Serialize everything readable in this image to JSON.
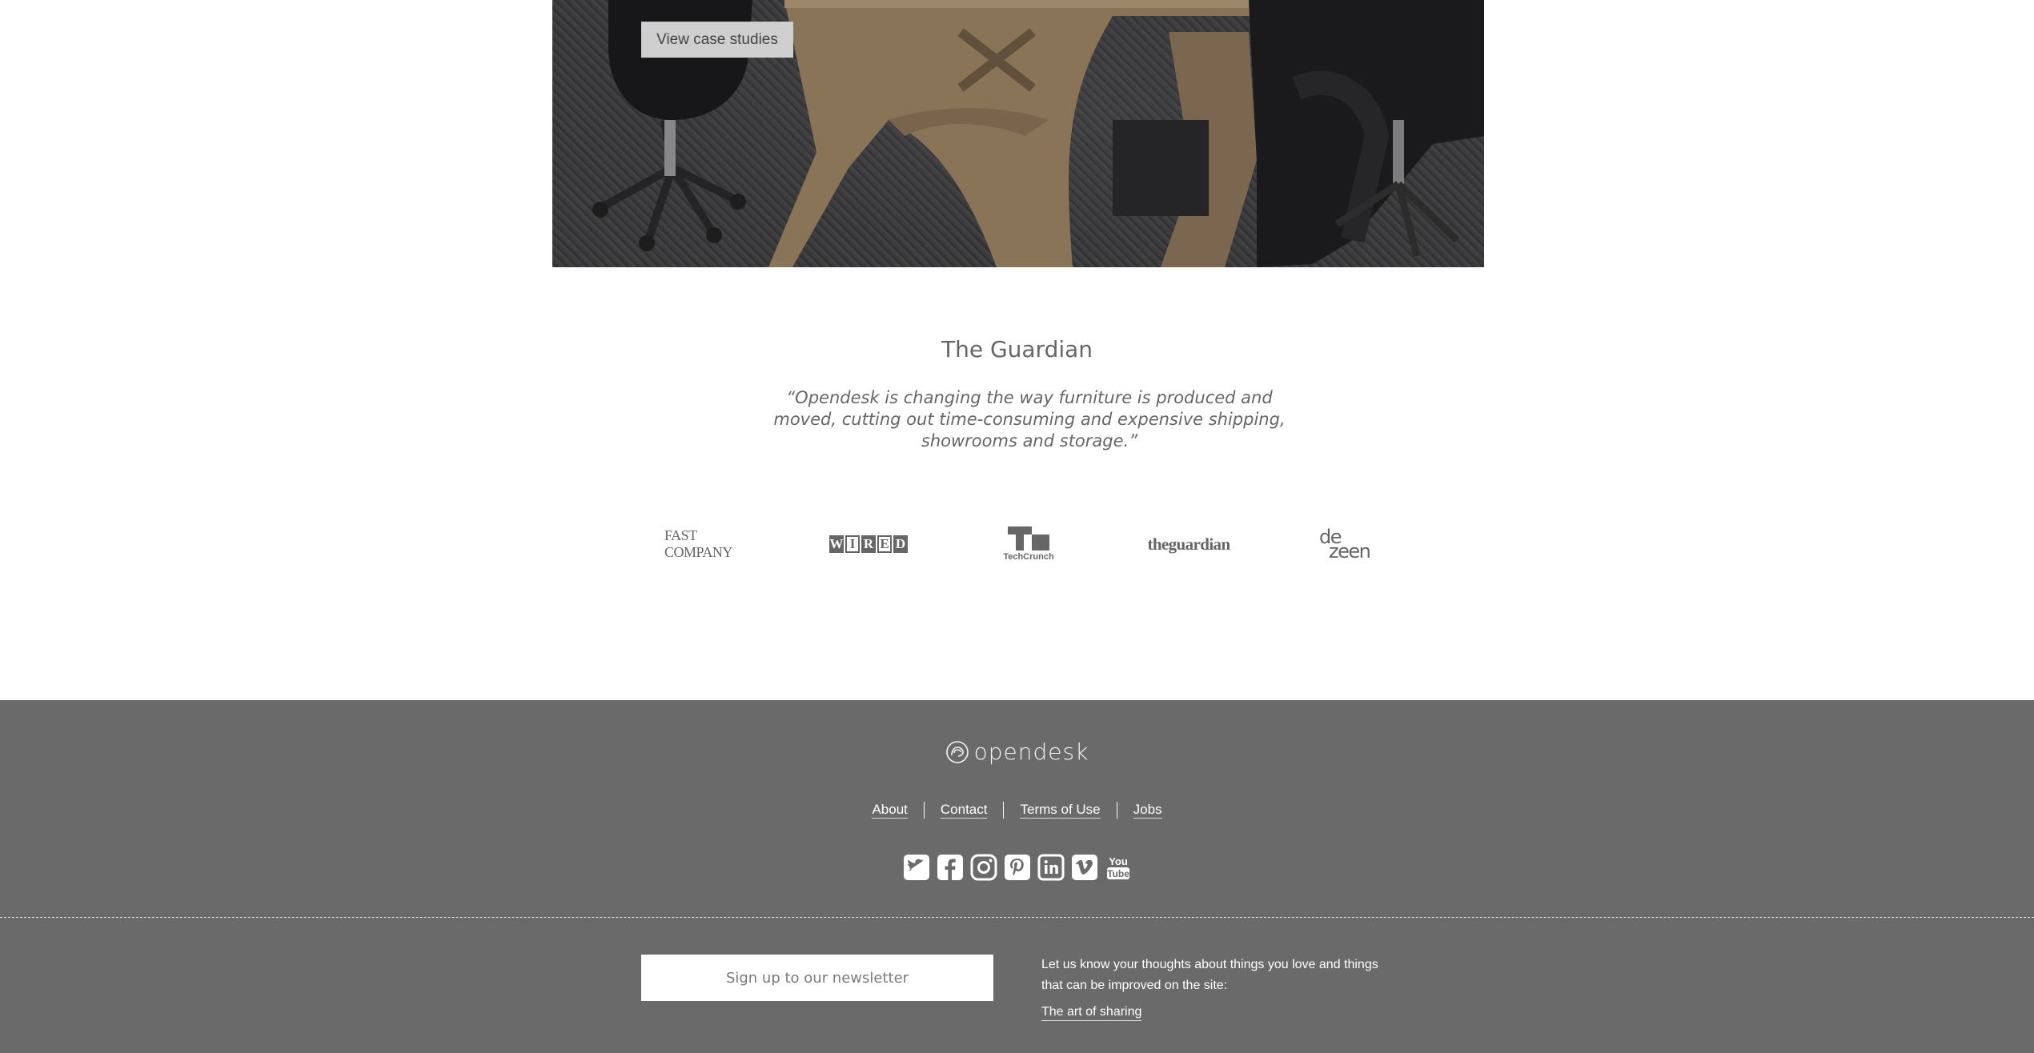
{
  "hero": {
    "button_label": "View case studies"
  },
  "testimonial": {
    "source": "The Guardian",
    "quote": "“Opendesk is changing the way furniture is produced and moved, cutting out time-consuming and expensive shipping, showrooms and storage.”"
  },
  "press_logos": {
    "fastcompany": "FAST COMPANY",
    "wired": [
      "W",
      "I",
      "R",
      "E",
      "D"
    ],
    "techcrunch_mark": "TC",
    "techcrunch_name": "TechCrunch",
    "guardian": "theguardian",
    "dezeen_top": "de",
    "dezeen_bottom": "zeen"
  },
  "footer": {
    "brand": "opendesk",
    "nav": [
      "About",
      "Contact",
      "Terms of Use",
      "Jobs"
    ],
    "social_icons": [
      "twitter-icon",
      "facebook-icon",
      "instagram-icon",
      "pinterest-icon",
      "linkedin-icon",
      "vimeo-icon",
      "youtube-icon"
    ],
    "newsletter_placeholder": "Sign up to our newsletter",
    "feedback_text": "Let us know your thoughts about things you love and things that can be improved on the site:",
    "feedback_link": "The art of sharing"
  },
  "colors": {
    "footer_bg": "#6a6a6a",
    "text_grey": "#666666",
    "button_bg": "#cfcfcf"
  }
}
